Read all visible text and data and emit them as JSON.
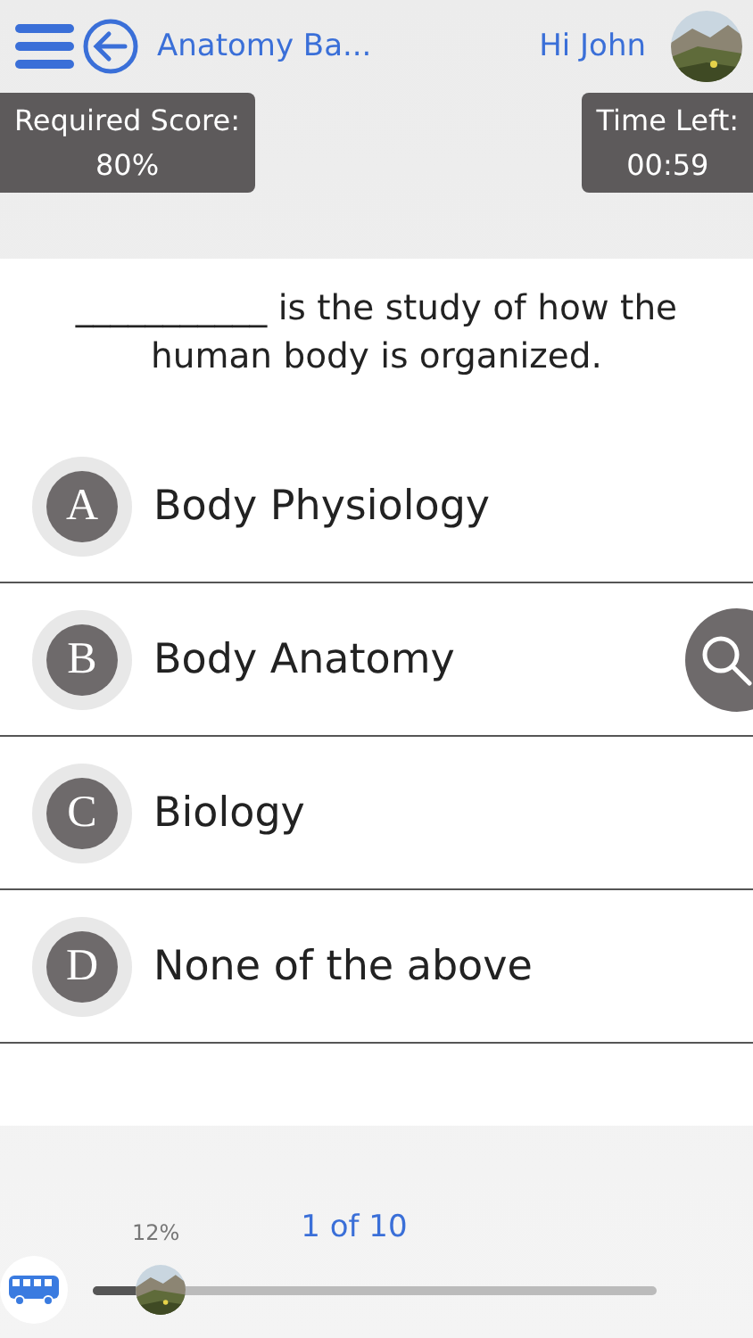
{
  "header": {
    "title": "Anatomy Ba...",
    "greeting": "Hi John"
  },
  "stats": [
    {
      "label": "Required Score:",
      "value": "80%"
    },
    {
      "label": "Time Left:",
      "value": "00:59"
    }
  ],
  "question": {
    "text": "___________ is the study of how the human body is organized."
  },
  "options": [
    {
      "letter": "A",
      "text": "Body Physiology"
    },
    {
      "letter": "B",
      "text": "Body Anatomy"
    },
    {
      "letter": "C",
      "text": "Biology"
    },
    {
      "letter": "D",
      "text": "None of the above"
    }
  ],
  "progress": {
    "percent": "12%",
    "level": 0.12,
    "counter": "1 of 10"
  }
}
